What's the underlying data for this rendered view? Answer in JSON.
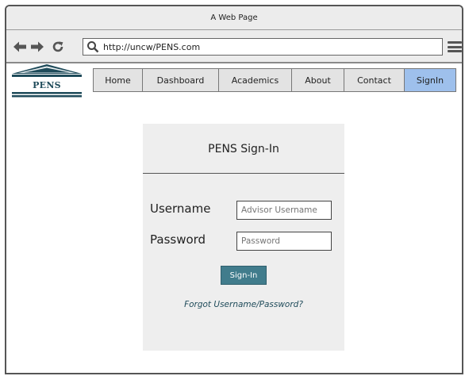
{
  "window": {
    "title": "A Web Page"
  },
  "toolbar": {
    "url": "http://uncw/PENS.com",
    "back_icon": "arrow-left-icon",
    "forward_icon": "arrow-right-icon",
    "reload_icon": "reload-icon",
    "search_icon": "magnifier-icon",
    "menu_icon": "hamburger-menu-icon"
  },
  "logo": {
    "text": "PENS",
    "color": "#1f4b5a"
  },
  "nav": {
    "items": [
      {
        "label": "Home"
      },
      {
        "label": "Dashboard"
      },
      {
        "label": "Academics"
      },
      {
        "label": "About"
      },
      {
        "label": "Contact"
      },
      {
        "label": "SignIn",
        "active": true
      }
    ],
    "active_color": "#9ec0ec"
  },
  "signin": {
    "title": "PENS Sign-In",
    "username_label": "Username",
    "username_placeholder": "Advisor Username",
    "password_label": "Password",
    "password_placeholder": "Password",
    "button_label": "Sign-In",
    "button_color": "#417c8c",
    "forgot_link": "Forgot Username/Password?"
  }
}
